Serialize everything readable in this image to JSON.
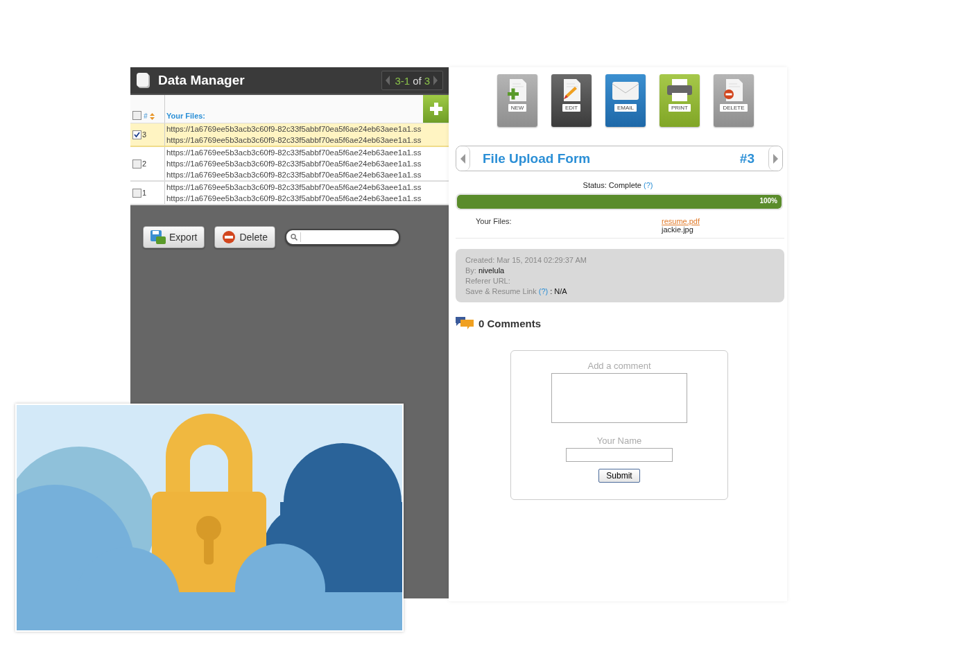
{
  "data_manager": {
    "title": "Data Manager",
    "pager": {
      "range": "3-1",
      "of": "of",
      "total": "3"
    },
    "table": {
      "select_all_checked": false,
      "hash": "#",
      "column": "Your Files:",
      "rows": [
        {
          "number": "3",
          "checked": true,
          "selected": true,
          "files": [
            "https://1a6769ee5b3acb3c60f9-82c33f5abbf70ea5f6ae24eb63aee1a1.ss",
            "https://1a6769ee5b3acb3c60f9-82c33f5abbf70ea5f6ae24eb63aee1a1.ss"
          ]
        },
        {
          "number": "2",
          "checked": false,
          "selected": false,
          "files": [
            "https://1a6769ee5b3acb3c60f9-82c33f5abbf70ea5f6ae24eb63aee1a1.ss",
            "https://1a6769ee5b3acb3c60f9-82c33f5abbf70ea5f6ae24eb63aee1a1.ss",
            "https://1a6769ee5b3acb3c60f9-82c33f5abbf70ea5f6ae24eb63aee1a1.ss"
          ]
        },
        {
          "number": "1",
          "checked": false,
          "selected": false,
          "files": [
            "https://1a6769ee5b3acb3c60f9-82c33f5abbf70ea5f6ae24eb63aee1a1.ss",
            "https://1a6769ee5b3acb3c60f9-82c33f5abbf70ea5f6ae24eb63aee1a1.ss"
          ]
        }
      ]
    },
    "actions": [
      {
        "kind": "export",
        "label": "Export"
      },
      {
        "kind": "delete",
        "label": "Delete"
      }
    ]
  },
  "toolbar": [
    {
      "kind": "new",
      "label": "NEW"
    },
    {
      "kind": "edit",
      "label": "EDIT"
    },
    {
      "kind": "email",
      "label": "EMAIL"
    },
    {
      "kind": "print",
      "label": "PRINT"
    },
    {
      "kind": "delete",
      "label": "DELETE"
    }
  ],
  "entry": {
    "title": "File Upload Form",
    "number": "#3",
    "status": "Status: Complete",
    "status_help": "(?)",
    "progress": {
      "level": 1,
      "reading": "100%"
    },
    "files_label": "Your Files:",
    "files": [
      {
        "name": "resume.pdf",
        "link": true
      },
      {
        "name": "jackie.jpg",
        "link": false
      }
    ],
    "meta": {
      "created": "Created: Mar 15, 2014 02:29:37 AM",
      "by_label": "By:",
      "by_value": "nivelula",
      "referrer": "Referer URL:",
      "save_label": "Save & Resume Link",
      "save_help": "(?)",
      "save_value": ": N/A"
    }
  },
  "comments": {
    "count": "0 Comments",
    "comment_label": "Add a comment",
    "name_label": "Your Name",
    "submit": "Submit"
  }
}
